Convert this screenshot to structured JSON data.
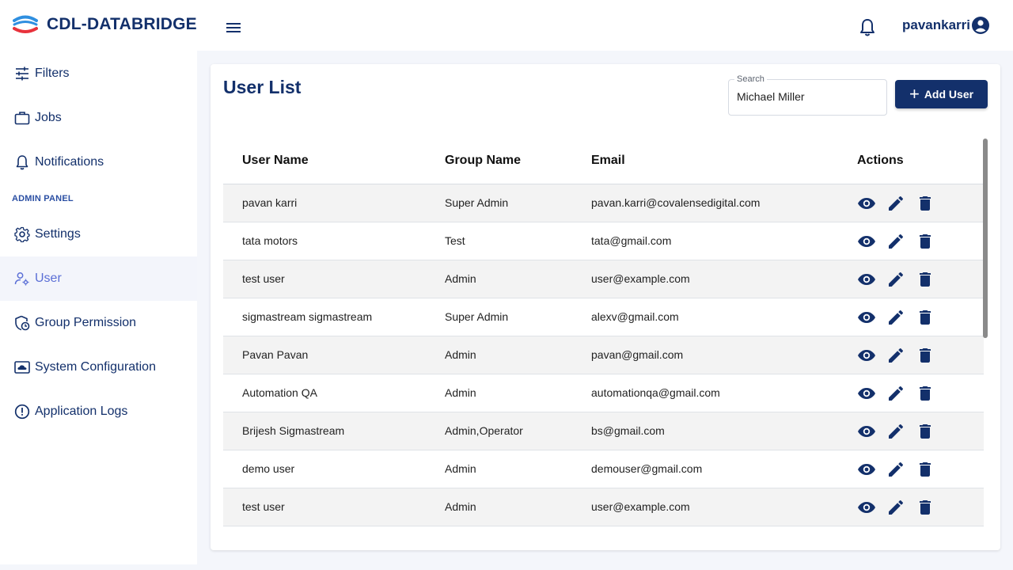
{
  "app": {
    "title": "CDL-DATABRIDGE"
  },
  "header": {
    "username": "pavankarri"
  },
  "sidebar": {
    "items": [
      {
        "label": "Filters",
        "icon": "tune-icon"
      },
      {
        "label": "Jobs",
        "icon": "briefcase-icon"
      },
      {
        "label": "Notifications",
        "icon": "bell-icon"
      },
      {
        "label": "Settings",
        "icon": "gear-icon"
      },
      {
        "label": "User",
        "icon": "user-settings-icon",
        "active": true
      },
      {
        "label": "Group Permission",
        "icon": "shield-clock-icon"
      },
      {
        "label": "System Configuration",
        "icon": "cloud-window-icon"
      },
      {
        "label": "Application Logs",
        "icon": "alert-circle-icon"
      }
    ],
    "section_label": "ADMIN PANEL"
  },
  "main": {
    "title": "User List",
    "search": {
      "legend": "Search",
      "value": "Michael Miller"
    },
    "add_button": "Add User",
    "columns": [
      "User Name",
      "Group Name",
      "Email",
      "Actions"
    ],
    "rows": [
      {
        "name": "pavan karri",
        "group": "Super Admin",
        "email": "pavan.karri@covalensedigital.com"
      },
      {
        "name": "tata motors",
        "group": "Test",
        "email": "tata@gmail.com"
      },
      {
        "name": "test user",
        "group": "Admin",
        "email": "user@example.com"
      },
      {
        "name": "sigmastream sigmastream",
        "group": "Super Admin",
        "email": "alexv@gmail.com"
      },
      {
        "name": "Pavan Pavan",
        "group": "Admin",
        "email": "pavan@gmail.com"
      },
      {
        "name": "Automation QA",
        "group": "Admin",
        "email": "automationqa@gmail.com"
      },
      {
        "name": "Brijesh Sigmastream",
        "group": "Admin,Operator",
        "email": "bs@gmail.com"
      },
      {
        "name": "demo user",
        "group": "Admin",
        "email": "demouser@gmail.com"
      },
      {
        "name": "test user",
        "group": "Admin",
        "email": "user@example.com"
      }
    ]
  },
  "colors": {
    "brand": "#13306b",
    "active_nav": "#5b6fd6",
    "logo_blue": "#2f8fe0",
    "logo_red": "#e8323c",
    "row_alt": "#f3f3f3"
  }
}
